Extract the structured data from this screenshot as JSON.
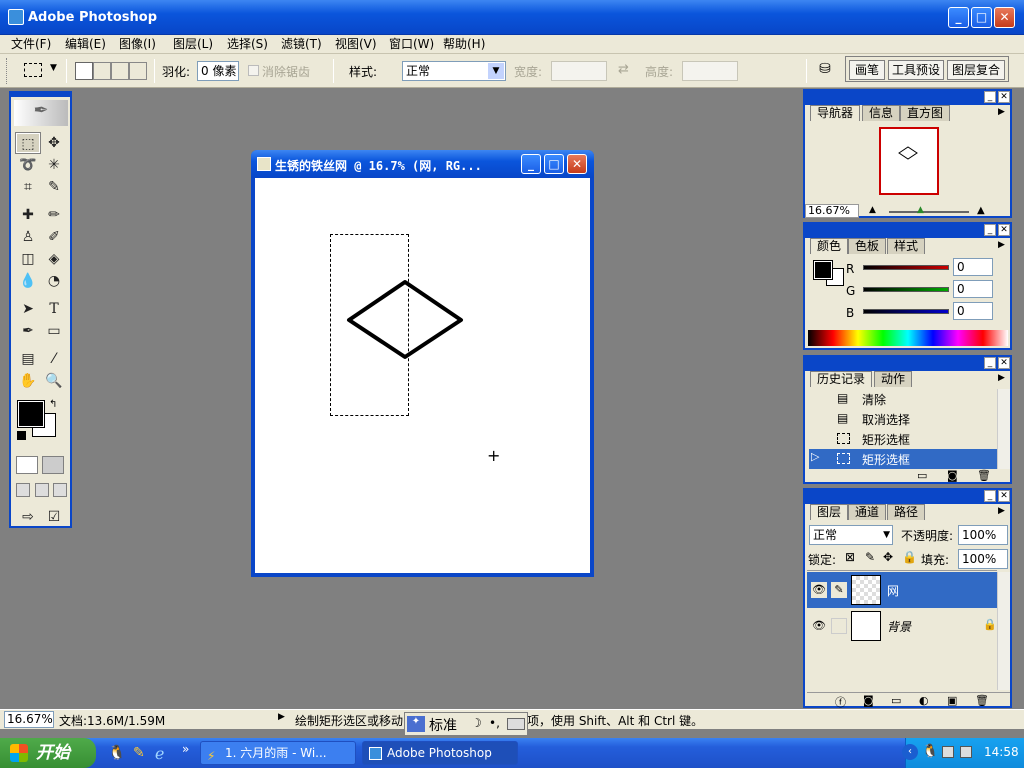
{
  "app": {
    "title": "Adobe Photoshop"
  },
  "menu": [
    "文件(F)",
    "编辑(E)",
    "图像(I)",
    "图层(L)",
    "选择(S)",
    "滤镜(T)",
    "视图(V)",
    "窗口(W)",
    "帮助(H)"
  ],
  "options": {
    "feather_label": "羽化:",
    "feather_value": "0 像素",
    "antialias_label": "消除锯齿",
    "style_label": "样式:",
    "style_value": "正常",
    "width_label": "宽度:",
    "height_label": "高度:",
    "panel_tabs": [
      "画笔",
      "工具预设",
      "图层复合"
    ]
  },
  "document": {
    "title": "生锈的铁丝网 @ 16.7% (网, RG..."
  },
  "navigator": {
    "tabs": [
      "导航器",
      "信息",
      "直方图"
    ],
    "zoom": "16.67%"
  },
  "color": {
    "tabs": [
      "颜色",
      "色板",
      "样式"
    ],
    "channels": [
      {
        "label": "R",
        "value": "0",
        "color": "#cc0000"
      },
      {
        "label": "G",
        "value": "0",
        "color": "#00aa00"
      },
      {
        "label": "B",
        "value": "0",
        "color": "#0000cc"
      }
    ]
  },
  "history": {
    "tabs": [
      "历史记录",
      "动作"
    ],
    "items": [
      "清除",
      "取消选择",
      "矩形选框",
      "矩形选框"
    ]
  },
  "layers": {
    "tabs": [
      "图层",
      "通道",
      "路径"
    ],
    "blend_mode": "正常",
    "opacity_label": "不透明度:",
    "opacity_value": "100%",
    "lock_label": "锁定:",
    "fill_label": "填充:",
    "fill_value": "100%",
    "items": [
      {
        "name": "网"
      },
      {
        "name": "背景"
      }
    ]
  },
  "status": {
    "zoom": "16.67%",
    "doc": "文档:13.6M/1.59M",
    "hint_left": "绘制矩形选区或移动",
    "hint_right": "项，使用 Shift、Alt 和 Ctrl 键。"
  },
  "ime": {
    "label": "标准"
  },
  "taskbar": {
    "start": "开始",
    "items": [
      "1. 六月的雨 - Wi...",
      "Adobe Photoshop"
    ],
    "time": "14:58"
  }
}
